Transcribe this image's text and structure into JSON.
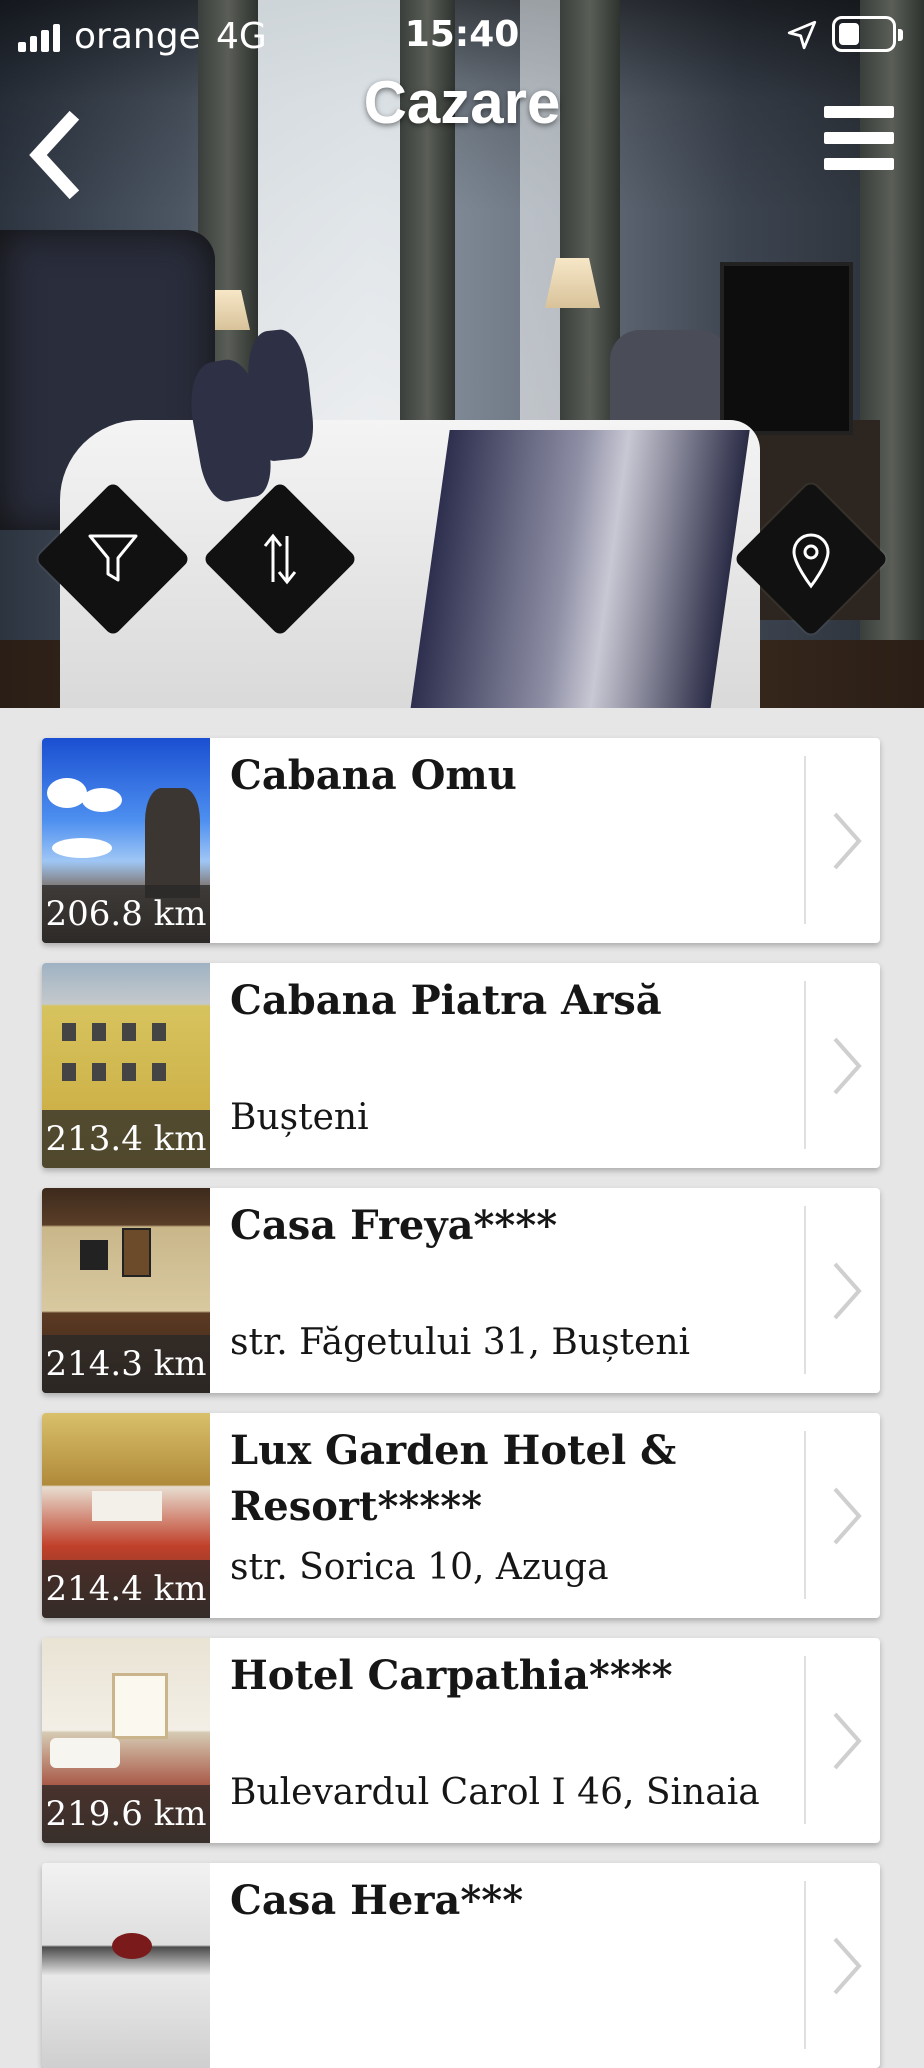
{
  "status_bar": {
    "carrier": "orange",
    "network": "4G",
    "time": "15:40",
    "battery_level": 0.35,
    "icons": [
      "signal-icon",
      "location-arrow-icon",
      "battery-icon"
    ]
  },
  "nav": {
    "title": "Cazare",
    "back_icon": "chevron-left-icon",
    "menu_icon": "hamburger-menu-icon"
  },
  "actions": [
    {
      "name": "filter",
      "icon": "filter-funnel-icon"
    },
    {
      "name": "sort",
      "icon": "sort-arrows-icon"
    },
    {
      "name": "map",
      "icon": "map-pin-icon"
    }
  ],
  "accommodations": [
    {
      "name": "Cabana Omu",
      "address": "",
      "distance": "206.8 km"
    },
    {
      "name": "Cabana Piatra Arsă",
      "address": "Bușteni",
      "distance": "213.4 km"
    },
    {
      "name": "Casa Freya****",
      "address": "str. Făgetului 31, Bușteni",
      "distance": "214.3 km"
    },
    {
      "name": "Lux Garden Hotel & Resort*****",
      "address": "str. Sorica 10, Azuga",
      "distance": "214.4 km"
    },
    {
      "name": "Hotel Carpathia****",
      "address": "Bulevardul Carol I 46, Sinaia",
      "distance": "219.6 km"
    },
    {
      "name": "Casa Hera***",
      "address": "",
      "distance": ""
    }
  ],
  "colors": {
    "background": "#e6e6e6",
    "card": "#ffffff",
    "text": "#161616",
    "button": "#111111"
  }
}
